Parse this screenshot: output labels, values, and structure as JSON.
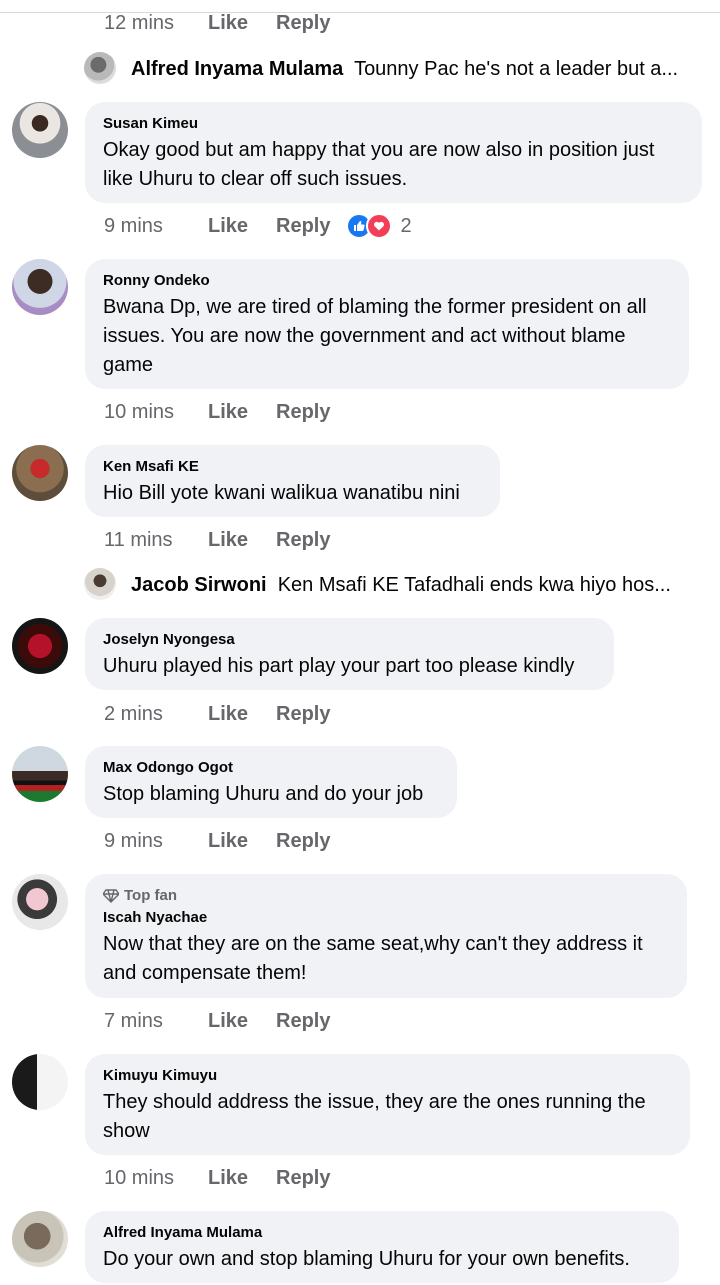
{
  "top_actions": {
    "time": "12 mins",
    "like": "Like",
    "reply": "Reply"
  },
  "replies": [
    {
      "name": "Alfred Inyama Mulama",
      "text": "Tounny Pac he's not a leader but a..."
    },
    {
      "name": "Jacob Sirwoni",
      "text": "Ken Msafi KE Tafadhali ends kwa hiyo hos..."
    }
  ],
  "comments": [
    {
      "name": "Susan Kimeu",
      "lines": [
        "Okay good but am happy that you are now also in position just",
        "like Uhuru to clear off such issues."
      ],
      "time": "9 mins",
      "like": "Like",
      "reply": "Reply",
      "reaction_count": "2"
    },
    {
      "name": "Ronny Ondeko",
      "lines": [
        "Bwana Dp, we are tired of blaming the former president on all",
        "issues. You are now the government and act without blame",
        "game"
      ],
      "time": "10 mins",
      "like": "Like",
      "reply": "Reply"
    },
    {
      "name": "Ken Msafi KE",
      "lines": [
        "Hio Bill yote kwani walikua wanatibu nini"
      ],
      "time": "11 mins",
      "like": "Like",
      "reply": "Reply"
    },
    {
      "name": "Joselyn Nyongesa",
      "lines": [
        "Uhuru played his part play your part too please kindly"
      ],
      "time": "2 mins",
      "like": "Like",
      "reply": "Reply"
    },
    {
      "name": "Max Odongo Ogot",
      "lines": [
        "Stop blaming Uhuru and do your job"
      ],
      "time": "9 mins",
      "like": "Like",
      "reply": "Reply"
    },
    {
      "badge": "Top fan",
      "name": "Iscah Nyachae",
      "lines": [
        "Now that they are on the same seat,why can't they address it",
        "and compensate them!"
      ],
      "time": "7 mins",
      "like": "Like",
      "reply": "Reply"
    },
    {
      "name": "Kimuyu Kimuyu",
      "lines": [
        "They should address the issue, they are the ones running the",
        "show"
      ],
      "time": "10 mins",
      "like": "Like",
      "reply": "Reply"
    },
    {
      "name": "Alfred Inyama Mulama",
      "lines": [
        "Do your own and stop blaming Uhuru for your own benefits."
      ]
    }
  ],
  "colors": {
    "bubble": "#f0f2f5",
    "meta": "#65676b",
    "like_blue": "#1877f2",
    "love_red": "#f33e58"
  }
}
